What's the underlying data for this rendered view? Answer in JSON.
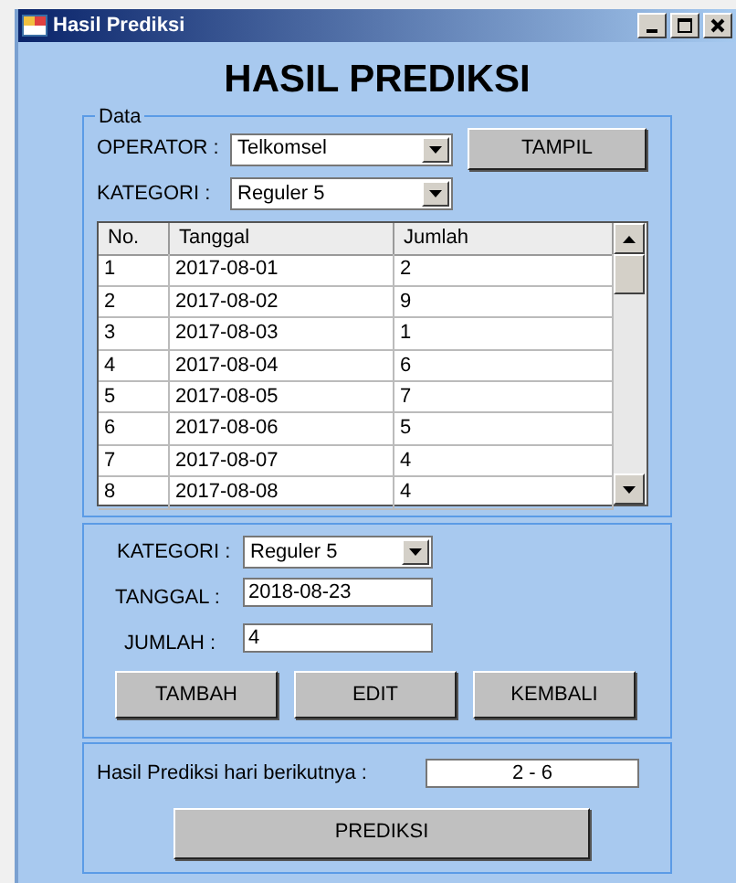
{
  "window": {
    "title": "Hasil Prediksi"
  },
  "heading": "HASIL PREDIKSI",
  "data_group": {
    "legend": "Data",
    "operator": {
      "label": "OPERATOR :",
      "value": "Telkomsel"
    },
    "show_button": "TAMPIL",
    "category": {
      "label": "KATEGORI :",
      "value": "Reguler 5"
    },
    "table": {
      "columns": [
        "No.",
        "Tanggal",
        "Jumlah"
      ],
      "rows": [
        [
          "1",
          "2017-08-01",
          "2"
        ],
        [
          "2",
          "2017-08-02",
          "9"
        ],
        [
          "3",
          "2017-08-03",
          "1"
        ],
        [
          "4",
          "2017-08-04",
          "6"
        ],
        [
          "5",
          "2017-08-05",
          "7"
        ],
        [
          "6",
          "2017-08-06",
          "5"
        ],
        [
          "7",
          "2017-08-07",
          "4"
        ],
        [
          "8",
          "2017-08-08",
          "4"
        ]
      ]
    }
  },
  "input_group": {
    "category": {
      "label": "KATEGORI :",
      "value": "Reguler 5"
    },
    "date": {
      "label": "TANGGAL :",
      "value": "2018-08-23"
    },
    "amount": {
      "label": "JUMLAH :",
      "value": "4"
    },
    "buttons": [
      "TAMBAH",
      "EDIT",
      "KEMBALI"
    ]
  },
  "result_group": {
    "label": "Hasil Prediksi hari berikutnya :",
    "value": "2 - 6",
    "button": "PREDIKSI"
  }
}
